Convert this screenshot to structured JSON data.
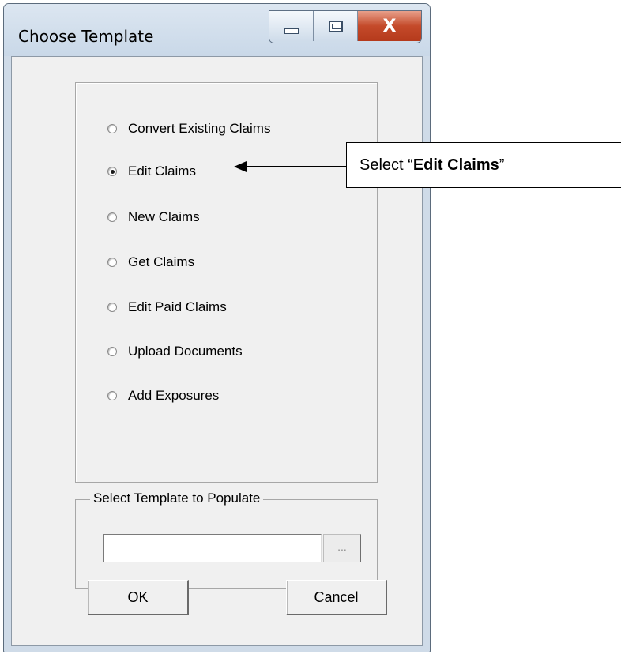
{
  "window": {
    "title": "Choose Template",
    "minimize_glyph": "",
    "maximize_glyph": "",
    "close_glyph": "X"
  },
  "options": {
    "items": [
      {
        "label": "Convert Existing Claims",
        "checked": false
      },
      {
        "label": "Edit Claims",
        "checked": true
      },
      {
        "label": "New Claims",
        "checked": false
      },
      {
        "label": "Get Claims",
        "checked": false
      },
      {
        "label": "Edit Paid Claims",
        "checked": false
      },
      {
        "label": "Upload Documents",
        "checked": false
      },
      {
        "label": "Add Exposures",
        "checked": false
      }
    ]
  },
  "file": {
    "legend": "Select Template to Populate",
    "value": "",
    "browse_label": "..."
  },
  "buttons": {
    "ok": "OK",
    "cancel": "Cancel"
  },
  "annotation": {
    "prefix": "Select “",
    "bold": "Edit Claims",
    "suffix": "”"
  }
}
